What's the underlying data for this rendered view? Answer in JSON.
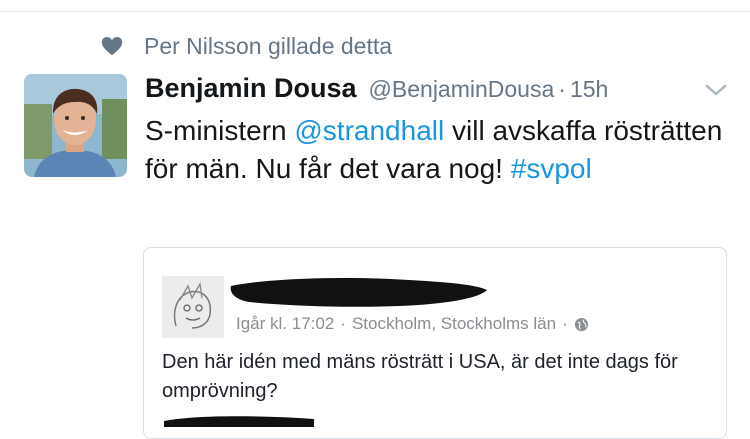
{
  "context": {
    "icon": "heart-icon",
    "text": "Per Nilsson gillade detta"
  },
  "tweet": {
    "author_name": "Benjamin Dousa",
    "handle": "@BenjaminDousa",
    "separator": "·",
    "time": "15h",
    "text_part1": "S-ministern ",
    "mention": "@strandhall",
    "text_part2": " vill avskaffa rösträtten för män. Nu får det vara nog! ",
    "hashtag": "#svpol",
    "link_color": "#1b95e0"
  },
  "quoted_post": {
    "meta_date": "Igår kl. 17:02",
    "meta_sep": "·",
    "meta_location": "Stockholm, Stockholms län",
    "meta_sep2": "·",
    "text": "Den här idén med mäns rösträtt i USA, är det inte dags för omprövning?"
  }
}
